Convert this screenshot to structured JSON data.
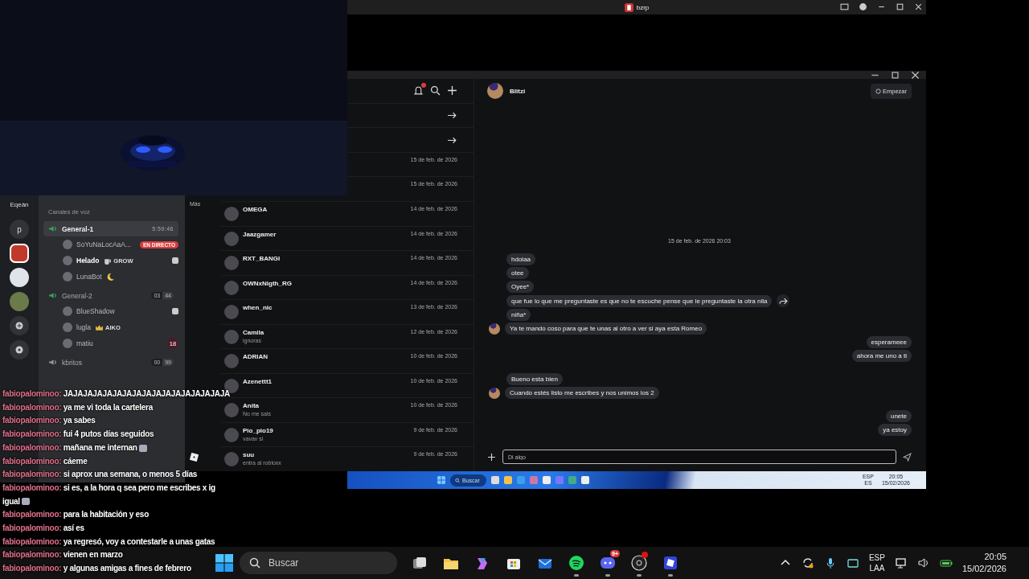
{
  "stream_camera": {
    "kind": "picture"
  },
  "top_window": {
    "title": "bzrp"
  },
  "discord": {
    "server_name": "Eqeán",
    "servers": [
      {
        "kind": "letter",
        "label": "p",
        "selected": false
      },
      {
        "kind": "picture",
        "selected": true
      },
      {
        "kind": "picture",
        "selected": false
      },
      {
        "kind": "picture",
        "selected": false
      },
      {
        "kind": "add",
        "selected": false
      },
      {
        "kind": "explore",
        "selected": false
      }
    ],
    "section": "Canales de voz",
    "channels": [
      {
        "name": "General-1",
        "selected": true,
        "active": true,
        "timer": "5:59:46",
        "members": [
          {
            "name": "SoYuNaLocAaA...",
            "highlighted": false,
            "live": "EN DIRECTO"
          },
          {
            "name": "Helado",
            "highlighted": true,
            "tag": {
              "kind": "cup",
              "text": "GROW"
            },
            "activity": true
          },
          {
            "name": "LunaBot",
            "highlighted": false,
            "tag": {
              "kind": "moon"
            }
          }
        ]
      },
      {
        "name": "General-2",
        "selected": false,
        "active": true,
        "counters": [
          "03",
          "44"
        ],
        "members": [
          {
            "name": "BlueShadow",
            "highlighted": false,
            "activity": true
          },
          {
            "name": "lugla",
            "highlighted": false,
            "tag": {
              "kind": "crown",
              "text": "AIKO"
            }
          },
          {
            "name": "matiu",
            "highlighted": false,
            "count": "18"
          }
        ]
      },
      {
        "name": "kbritos",
        "selected": false,
        "active": false,
        "counters": [
          "00",
          "99"
        ]
      }
    ]
  },
  "roblox": {
    "more_label": "Más",
    "conversations": [
      {
        "kind": "action"
      },
      {
        "kind": "action"
      },
      {
        "kind": "chat",
        "date": "15 de feb. de 2026"
      },
      {
        "kind": "chat",
        "date": "15 de feb. de 2026"
      },
      {
        "kind": "chat",
        "name": "OMEGA",
        "date": "14 de feb. de 2026"
      },
      {
        "kind": "chat",
        "name": "Jaazgamer",
        "date": "14 de feb. de 2026"
      },
      {
        "kind": "chat",
        "name": "RXT_BANGI",
        "date": "14 de feb. de 2026"
      },
      {
        "kind": "chat",
        "name": "OWNxNigth_RG",
        "date": "14 de feb. de 2026"
      },
      {
        "kind": "chat",
        "name": "when_nic",
        "date": "13 de feb. de 2026"
      },
      {
        "kind": "chat",
        "name": "Camila",
        "preview": "ignoras",
        "date": "12 de feb. de 2026"
      },
      {
        "kind": "chat",
        "name": "ADRIAN",
        "date": "10 de feb. de 2026"
      },
      {
        "kind": "chat",
        "name": "Azenettt1",
        "date": "10 de feb. de 2026"
      },
      {
        "kind": "chat",
        "name": "Anita",
        "preview": "No me sals",
        "date": "10 de feb. de 2026"
      },
      {
        "kind": "chat",
        "name": "Pio_pio19",
        "preview": "vavav si",
        "date": "9 de feb. de 2026"
      },
      {
        "kind": "chat",
        "name": "suu",
        "preview": "entra al robloxx",
        "date": "9 de feb. de 2026"
      }
    ],
    "chat": {
      "contact": "Blitzi",
      "start_button": "Empezar",
      "timestamp": "15 de feb. de 2026 20:03",
      "messages": [
        {
          "kind": "received",
          "text": "hdolaa"
        },
        {
          "kind": "received",
          "text": "otee"
        },
        {
          "kind": "received",
          "text": "Oyee*"
        },
        {
          "kind": "received",
          "text": "que fue lo que me preguntaste es que no te escuche pense que le preguntaste la otra nila",
          "share": true
        },
        {
          "kind": "received",
          "text": "niña*"
        },
        {
          "kind": "received",
          "text": "Ya te mando coso para que te unas al otro a ver si aya esta Romeo",
          "avatar": true
        },
        {
          "kind": "sent",
          "text": "esperameee"
        },
        {
          "kind": "sent",
          "text": "ahora me uno a ti"
        },
        {
          "kind": "received",
          "text": "Bueno esta bien",
          "gap": true
        },
        {
          "kind": "received",
          "text": "Cuando estés listo me escribes y nos unimos los 2",
          "avatar": true
        },
        {
          "kind": "sent",
          "text": "unete",
          "gap": true
        },
        {
          "kind": "sent",
          "text": "ya estoy"
        }
      ],
      "input": {
        "placeholder": "Di algo"
      }
    }
  },
  "inner_taskbar": {
    "search": "Buscar",
    "lang": [
      "ESP",
      "ES"
    ],
    "time": "20:05",
    "date": "15/02/2026"
  },
  "stream_chat": [
    {
      "user": "fabiopalominoo:",
      "text": "JAJAJAJAJAJAJAJAJAJAJAJAJAJAJAJAJA"
    },
    {
      "user": "fabiopalominoo:",
      "text": "ya me vi toda la cartelera"
    },
    {
      "user": "fabiopalominoo:",
      "text": "ya sabes"
    },
    {
      "user": "fabiopalominoo:",
      "text": "fui 4 putos días seguidos"
    },
    {
      "user": "fabiopalominoo:",
      "text": "mañana me internan",
      "emote": true
    },
    {
      "user": "fabiopalominoo:",
      "text": "cáeme"
    },
    {
      "user": "fabiopalominoo:",
      "text": "si aprox una semana, o menos 5 días"
    },
    {
      "user": "fabiopalominoo:",
      "text": "si es, a la hora q sea pero me escribes x ig igual",
      "emote": true
    },
    {
      "user": "fabiopalominoo:",
      "text": "para la habitación y eso"
    },
    {
      "user": "fabiopalominoo:",
      "text": "así es"
    },
    {
      "user": "fabiopalominoo:",
      "text": "ya regresó, voy a contestarle a unas gatas"
    },
    {
      "user": "fabiopalominoo:",
      "text": "vienen en marzo"
    },
    {
      "user": "fabiopalominoo:",
      "text": "y algunas amigas a fines de febrero"
    }
  ],
  "taskbar": {
    "search": "Buscar",
    "apps": [
      {
        "kind": "task-view",
        "running": false
      },
      {
        "kind": "folder",
        "running": false
      },
      {
        "kind": "copilot",
        "running": false
      },
      {
        "kind": "store",
        "running": false
      },
      {
        "kind": "mail",
        "running": false
      },
      {
        "kind": "spotify",
        "running": true
      },
      {
        "kind": "discord",
        "running": true,
        "badge": "9+"
      },
      {
        "kind": "obs",
        "running": true,
        "alert": true
      },
      {
        "kind": "roblox",
        "running": true
      }
    ],
    "lang": [
      "ESP",
      "LAA"
    ],
    "time": "20:05",
    "date": "15/02/2026"
  }
}
